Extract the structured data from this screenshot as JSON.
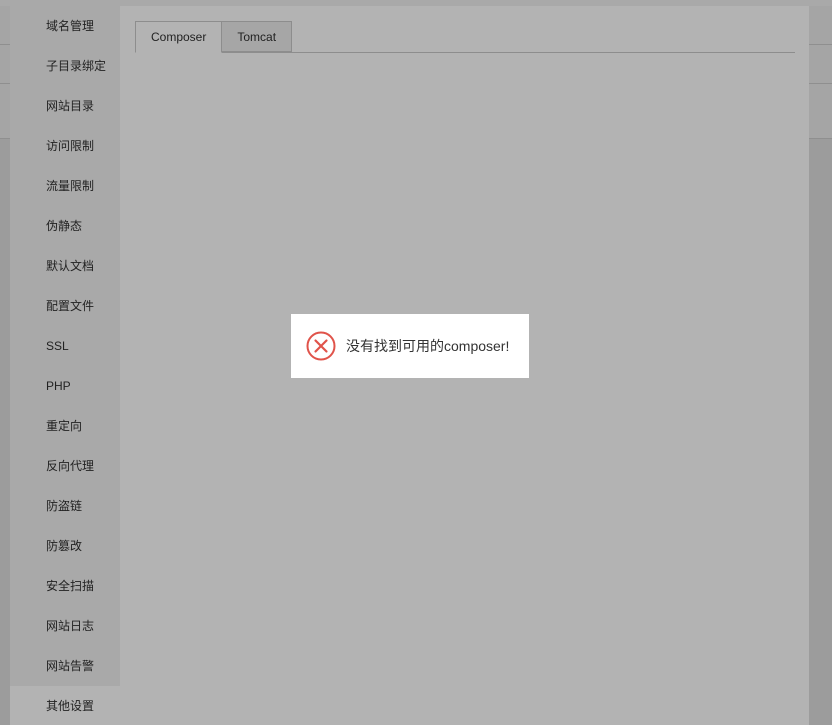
{
  "sidebar": {
    "items": [
      {
        "label": "域名管理"
      },
      {
        "label": "子目录绑定"
      },
      {
        "label": "网站目录"
      },
      {
        "label": "访问限制"
      },
      {
        "label": "流量限制"
      },
      {
        "label": "伪静态"
      },
      {
        "label": "默认文档"
      },
      {
        "label": "配置文件"
      },
      {
        "label": "SSL"
      },
      {
        "label": "PHP"
      },
      {
        "label": "重定向"
      },
      {
        "label": "反向代理"
      },
      {
        "label": "防盗链"
      },
      {
        "label": "防篡改"
      },
      {
        "label": "安全扫描"
      },
      {
        "label": "网站日志"
      },
      {
        "label": "网站告警"
      },
      {
        "label": "其他设置"
      }
    ],
    "active_index": 17
  },
  "tabs": [
    {
      "label": "Composer"
    },
    {
      "label": "Tomcat"
    }
  ],
  "toast": {
    "icon": "error-circle-x-icon",
    "message": "没有找到可用的composer!"
  },
  "colors": {
    "error": "#e0534a",
    "overlay": "#9c9c9c",
    "toast_bg": "#ffffff"
  }
}
